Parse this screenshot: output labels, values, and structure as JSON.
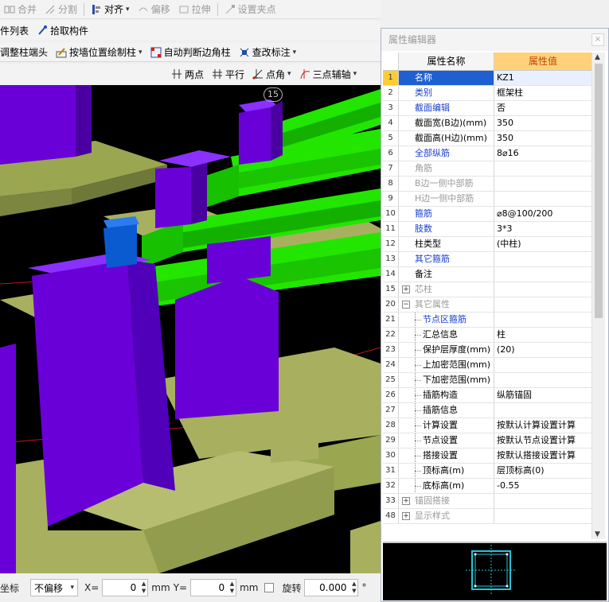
{
  "toolbar1": {
    "merge": "合并",
    "split": "分割",
    "align": "对齐",
    "offset": "偏移",
    "stretch": "拉伸",
    "set_grip": "设置夹点"
  },
  "toolbar2": {
    "component_list": "件列表",
    "pick_component": "拾取构件"
  },
  "toolbar3": {
    "adjust_column_end": "调整柱端头",
    "draw_by_wall": "按墙位置绘制柱",
    "auto_corner": "自动判断边角柱",
    "check_label": "查改标注"
  },
  "toolbar4": {
    "two_points": "两点",
    "parallel": "平行",
    "point_angle": "点角",
    "three_point_aux": "三点辅轴"
  },
  "viewport": {
    "axis_number": "15"
  },
  "statusbar": {
    "coord_label": "坐标",
    "offset_mode": "不偏移",
    "x_label": "X=",
    "x_value": "0",
    "x_unit": "mm",
    "y_label": "Y=",
    "y_value": "0",
    "y_unit": "mm",
    "rotate_label": "旋转",
    "rotate_value": "0.000",
    "degree": "°"
  },
  "panel": {
    "title": "属性编辑器",
    "col_name": "属性名称",
    "col_value": "属性值",
    "rows": [
      {
        "n": "1",
        "name": "名称",
        "value": "KZ1"
      },
      {
        "n": "2",
        "name": "类别",
        "value": "框架柱"
      },
      {
        "n": "3",
        "name": "截面编辑",
        "value": "否"
      },
      {
        "n": "4",
        "name": "截面宽(B边)(mm)",
        "value": "350"
      },
      {
        "n": "5",
        "name": "截面高(H边)(mm)",
        "value": "350"
      },
      {
        "n": "6",
        "name": "全部纵筋",
        "value": "8⌀16"
      },
      {
        "n": "7",
        "name": "角筋",
        "value": ""
      },
      {
        "n": "8",
        "name": "B边一侧中部筋",
        "value": ""
      },
      {
        "n": "9",
        "name": "H边一侧中部筋",
        "value": ""
      },
      {
        "n": "10",
        "name": "箍筋",
        "value": "⌀8@100/200"
      },
      {
        "n": "11",
        "name": "肢数",
        "value": "3*3"
      },
      {
        "n": "12",
        "name": "柱类型",
        "value": "(中柱)"
      },
      {
        "n": "13",
        "name": "其它箍筋",
        "value": ""
      },
      {
        "n": "14",
        "name": "备注",
        "value": ""
      },
      {
        "n": "15",
        "name": "芯柱",
        "value": ""
      },
      {
        "n": "20",
        "name": "其它属性",
        "value": ""
      },
      {
        "n": "21",
        "name": "节点区箍筋",
        "value": ""
      },
      {
        "n": "22",
        "name": "汇总信息",
        "value": "柱"
      },
      {
        "n": "23",
        "name": "保护层厚度(mm)",
        "value": "(20)"
      },
      {
        "n": "24",
        "name": "上加密范围(mm)",
        "value": ""
      },
      {
        "n": "25",
        "name": "下加密范围(mm)",
        "value": ""
      },
      {
        "n": "26",
        "name": "插筋构造",
        "value": "纵筋锚固"
      },
      {
        "n": "27",
        "name": "插筋信息",
        "value": ""
      },
      {
        "n": "28",
        "name": "计算设置",
        "value": "按默认计算设置计算"
      },
      {
        "n": "29",
        "name": "节点设置",
        "value": "按默认节点设置计算"
      },
      {
        "n": "30",
        "name": "搭接设置",
        "value": "按默认搭接设置计算"
      },
      {
        "n": "31",
        "name": "顶标高(m)",
        "value": "层顶标高(0)"
      },
      {
        "n": "32",
        "name": "底标高(m)",
        "value": "-0.55"
      },
      {
        "n": "33",
        "name": "锚固搭接",
        "value": ""
      },
      {
        "n": "48",
        "name": "显示样式",
        "value": ""
      }
    ]
  },
  "colors": {
    "column": "#6a00d8",
    "beam": "#22e600",
    "slab": "#a8b060",
    "selected_column": "#0b5bd0"
  }
}
